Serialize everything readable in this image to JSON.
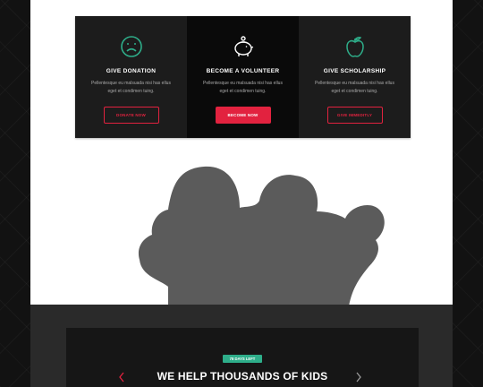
{
  "cards": [
    {
      "icon": "sad-face-icon",
      "title": "GIVE DONATION",
      "text": "Pellentesque eu malsuada nisi has ellus eget et condimen tuing.",
      "button": "DONATE NOW",
      "style": "outline"
    },
    {
      "icon": "piggy-bank-icon",
      "title": "BECOME A VOLUNTEER",
      "text": "Pellentesque eu malsuada nisi has ellus eget et condimen tuing.",
      "button": "BECOME NOW",
      "style": "solid"
    },
    {
      "icon": "apple-icon",
      "title": "GIVE SCHOLARSHIP",
      "text": "Pellentesque eu malsuada nisi has ellus eget et condimen tuing.",
      "button": "GIVE IMMEDITLY",
      "style": "outline"
    }
  ],
  "banner": {
    "badge": "78 DAYS LEFT",
    "headline": "WE HELP THOUSANDS OF KIDS"
  },
  "colors": {
    "accent": "#e2223f",
    "icon": "#2eae8a",
    "badge": "#2eae8a"
  }
}
